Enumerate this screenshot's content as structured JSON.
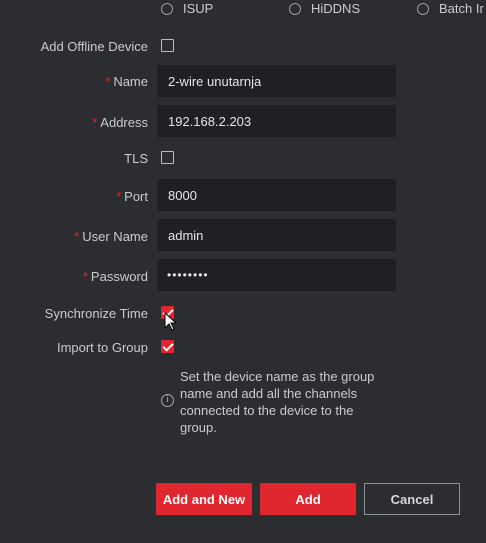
{
  "add_method": {
    "options": [
      "ISUP",
      "HiDDNS",
      "Batch Ir"
    ]
  },
  "form": {
    "offline_device": {
      "label": "Add Offline Device",
      "checked": false
    },
    "name": {
      "label": "Name",
      "value": "2-wire unutarnja"
    },
    "address": {
      "label": "Address",
      "value": "192.168.2.203"
    },
    "tls": {
      "label": "TLS",
      "checked": false
    },
    "port": {
      "label": "Port",
      "value": "8000"
    },
    "user_name": {
      "label": "User Name",
      "value": "admin"
    },
    "password": {
      "label": "Password",
      "masked": "••••••••"
    },
    "sync_time": {
      "label": "Synchronize Time",
      "checked": true
    },
    "import_group": {
      "label": "Import to Group",
      "checked": true
    },
    "required_mark": "*",
    "info_text": "Set the device name as the group name and add all the channels connected to the device to the group."
  },
  "actions": {
    "add_and_new": "Add and New",
    "add": "Add",
    "cancel": "Cancel"
  },
  "colors": {
    "accent": "#e0262e",
    "background": "#2b2d31",
    "input_bg": "#1f2024"
  }
}
